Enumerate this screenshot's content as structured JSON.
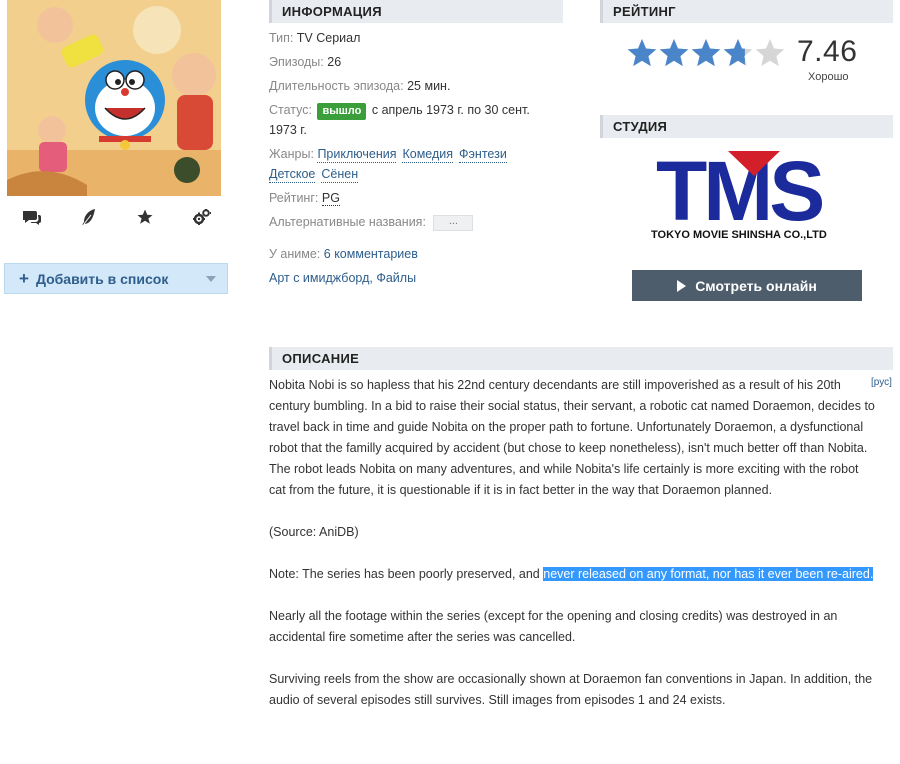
{
  "info": {
    "header": "ИНФОРМАЦИЯ",
    "type_key": "Тип:",
    "type_val": "TV Сериал",
    "episodes_key": "Эпизоды:",
    "episodes_val": "26",
    "duration_key": "Длительность эпизода:",
    "duration_val": "25 мин.",
    "status_key": "Статус:",
    "status_badge": "вышло",
    "status_dates": "с апрель 1973 г. по 30 сент. 1973 г.",
    "genres_key": "Жанры:",
    "genres": [
      "Приключения",
      "Комедия",
      "Фэнтези",
      "Детское",
      "Сёнен"
    ],
    "rating_key": "Рейтинг:",
    "rating_val": "PG",
    "alt_key": "Альтернативные названия:",
    "alt_btn": "...",
    "anime_key": "У аниме:",
    "comments": "6 комментариев",
    "art": "Арт с имиджборд",
    "files": "Файлы"
  },
  "rating": {
    "header": "РЕЙТИНГ",
    "score": "7.46",
    "score_value": 7.46,
    "stars_max": 5,
    "label": "Хорошо",
    "star_color": "#4a84c9",
    "star_empty_color": "#d6d6d6"
  },
  "studio": {
    "header": "СТУДИЯ",
    "logo_text": "TMS",
    "logo_sub": "TOKYO MOVIE SHINSHA CO.,LTD",
    "watch_btn": "Смотреть онлайн"
  },
  "left": {
    "add_list": "Добавить в список",
    "icons": [
      "comments-icon",
      "feather-icon",
      "star-icon",
      "gears-icon"
    ]
  },
  "description": {
    "header": "ОПИСАНИЕ",
    "lang": "[рус]",
    "p1": "Nobita Nobi is so hapless that his 22nd century decendants are still impoverished as a result of his 20th century bumbling. In a bid to raise their social status, their servant, a robotic cat named Doraemon, decides to travel back in time and guide Nobita on the proper path to fortune. Unfortunately Doraemon, a dysfunctional robot that the familly acquired by accident (but chose to keep nonetheless), isn't much better off than Nobita. The robot leads Nobita on many adventures, and while Nobita's life certainly is more exciting with the robot cat from the future, it is questionable if it is in fact better in the way that Doraemon planned.",
    "p2": "(Source: AniDB)",
    "p3_a": "Note: The series has been poorly preserved, and ",
    "p3_hl": "never released on any format, nor has it ever been re-aired.",
    "p4": "Nearly all the footage within the series (except for the opening and closing credits) was destroyed in an accidental fire sometime after the series was cancelled.",
    "p5": "Surviving reels from the show are occasionally shown at Doraemon fan conventions in Japan. In addition, the audio of several episodes still survives. Still images from episodes 1 and 24 exists."
  }
}
